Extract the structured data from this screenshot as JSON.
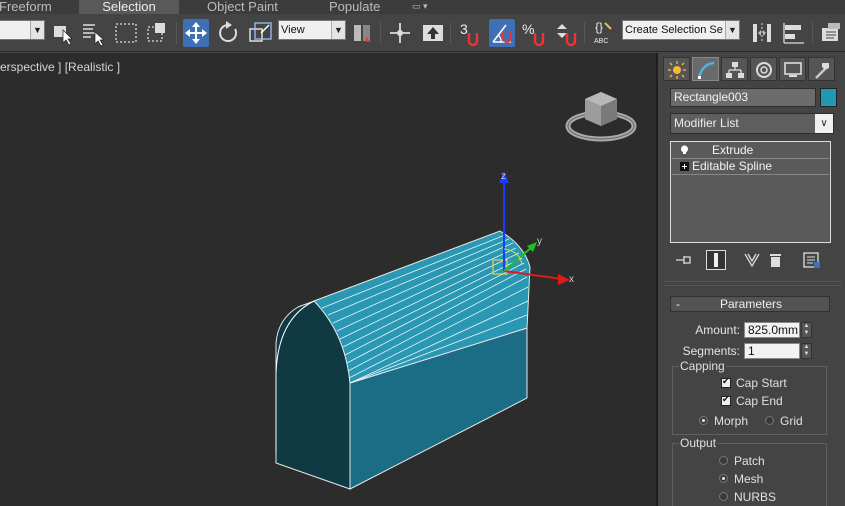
{
  "ribbon": {
    "tabs": [
      {
        "label": "Freeform"
      },
      {
        "label": "Selection"
      },
      {
        "label": "Object Paint"
      },
      {
        "label": "Populate"
      }
    ]
  },
  "toolbar": {
    "selection_filter": "",
    "reference_coord": "View",
    "named_selection_placeholder": "Create Selection Se"
  },
  "viewport": {
    "label": "erspective ] [Realistic ]",
    "gizmo_axes": {
      "x": "x",
      "y": "y",
      "z": "z"
    }
  },
  "command_panel": {
    "object_name": "Rectangle003",
    "object_color": "#1e9ab4",
    "modifier_list": "Modifier List",
    "modifier_stack": [
      {
        "label": "Extrude"
      },
      {
        "label": "Editable Spline"
      }
    ],
    "rollout": {
      "title": "Parameters",
      "toggle": "-",
      "amount_label": "Amount:",
      "amount_value": "825.0mm",
      "segments_label": "Segments:",
      "segments_value": "1",
      "capping": {
        "title": "Capping",
        "cap_start": "Cap Start",
        "cap_end": "Cap End",
        "morph": "Morph",
        "grid": "Grid"
      },
      "output": {
        "title": "Output",
        "patch": "Patch",
        "mesh": "Mesh",
        "nurbs": "NURBS"
      }
    }
  }
}
